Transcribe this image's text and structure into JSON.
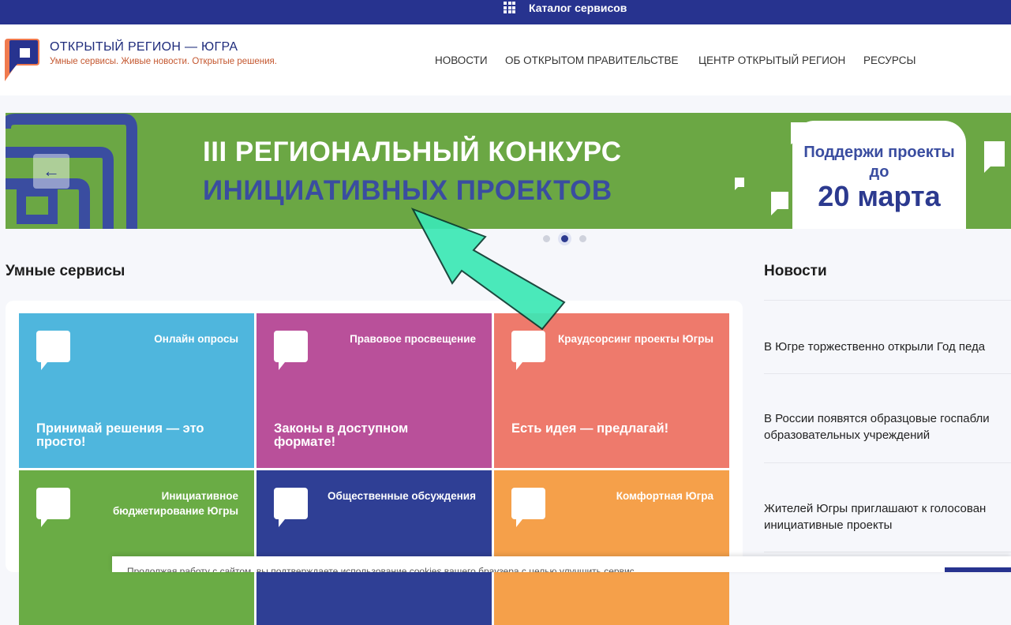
{
  "topbar": {
    "catalog_label": "Каталог сервисов",
    "icon": "grid-icon"
  },
  "brand": {
    "title": "ОТКРЫТЫЙ РЕГИОН — ЮГРА",
    "subtitle": "Умные сервисы. Живые новости. Открытые решения."
  },
  "nav": [
    "НОВОСТИ",
    "ОБ ОТКРЫТОМ ПРАВИТЕЛЬСТВЕ",
    "ЦЕНТР ОТКРЫТЫЙ РЕГИОН",
    "РЕСУРСЫ"
  ],
  "banner": {
    "line1": "III РЕГИОНАЛЬНЫЙ КОНКУРС",
    "line2": "ИНИЦИАТИВНЫХ ПРОЕКТОВ",
    "promo_text": "Поддержи проекты до",
    "promo_date": "20 марта",
    "prev_icon": "←",
    "active_slide": 2,
    "slides_count": 3
  },
  "services": {
    "title": "Умные сервисы",
    "tiles": [
      {
        "name": "Онлайн опросы",
        "slogan": "Принимай решения — это просто!",
        "color": "#4fb6dd"
      },
      {
        "name": "Правовое просвещение",
        "slogan": "Законы в доступном формате!",
        "color": "#b9509a"
      },
      {
        "name": "Краудсорсинг проекты Югры",
        "slogan": "Есть идея — предлагай!",
        "color": "#ee7a6c"
      },
      {
        "name": "Инициативное бюджетирование Югры",
        "slogan": "",
        "color": "#6aac45"
      },
      {
        "name": "Общественные обсуждения",
        "slogan": "",
        "color": "#2f3f95"
      },
      {
        "name": "Комфортная Югра",
        "slogan": "",
        "color": "#f5a04a"
      }
    ]
  },
  "news": {
    "title": "Новости",
    "items": [
      "В Югре торжественно открыли Год педа",
      "В России появятся образцовые госпабли\nобразовательных учреждений",
      "Жителей Югры приглашают к голосован\nинициативные проекты"
    ]
  },
  "cookie": {
    "text": "Продолжая работу с сайтом, вы подтверждаете использование cookies вашего браузера с целью улучшить сервис."
  },
  "colors": {
    "primary": "#27338f",
    "banner_green": "#6ba744",
    "accent": "#c4572f"
  }
}
